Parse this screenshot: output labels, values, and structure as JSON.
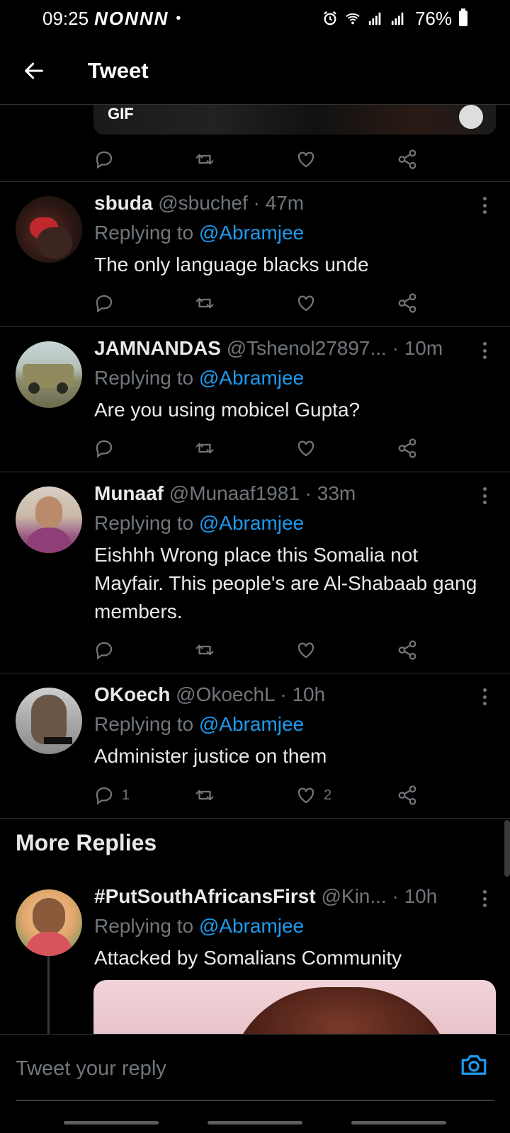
{
  "status_bar": {
    "time": "09:25",
    "notification_icons": "NONNN",
    "dot": "•",
    "battery": "76%"
  },
  "header": {
    "title": "Tweet"
  },
  "media": {
    "badge": "GIF"
  },
  "tweets": [
    {
      "name": "sbuda",
      "handle": "@sbuchef",
      "time": "· 47m",
      "replying_label": "Replying to",
      "replying_handle": "@Abramjee",
      "text": "The only language blacks unde",
      "reply_count": "",
      "like_count": ""
    },
    {
      "name": "JAMNANDAS",
      "handle": "@Tshenol27897...",
      "time": "· 10m",
      "replying_label": "Replying to",
      "replying_handle": "@Abramjee",
      "text": "Are you using mobicel Gupta?",
      "reply_count": "",
      "like_count": ""
    },
    {
      "name": "Munaaf",
      "handle": "@Munaaf1981",
      "time": "· 33m",
      "replying_label": "Replying to",
      "replying_handle": "@Abramjee",
      "text": "Eishhh Wrong place this Somalia not Mayfair. This people's are Al-Shabaab gang members.",
      "reply_count": "",
      "like_count": ""
    },
    {
      "name": "OKoech",
      "handle": "@OkoechL",
      "time": "· 10h",
      "replying_label": "Replying to",
      "replying_handle": "@Abramjee",
      "text": "Administer justice on them",
      "reply_count": "1",
      "like_count": "2"
    },
    {
      "name": "#PutSouthAfricansFirst",
      "handle": "@Kin...",
      "time": "· 10h",
      "replying_label": "Replying to",
      "replying_handle": "@Abramjee",
      "text": "Attacked by Somalians Community",
      "reply_count": "",
      "like_count": ""
    }
  ],
  "more_replies": {
    "title": "More Replies"
  },
  "reply_bar": {
    "placeholder": "Tweet your reply"
  },
  "colors": {
    "background": "#000000",
    "link": "#1d9bf0",
    "muted": "#71767b",
    "divider": "#2f3336"
  }
}
